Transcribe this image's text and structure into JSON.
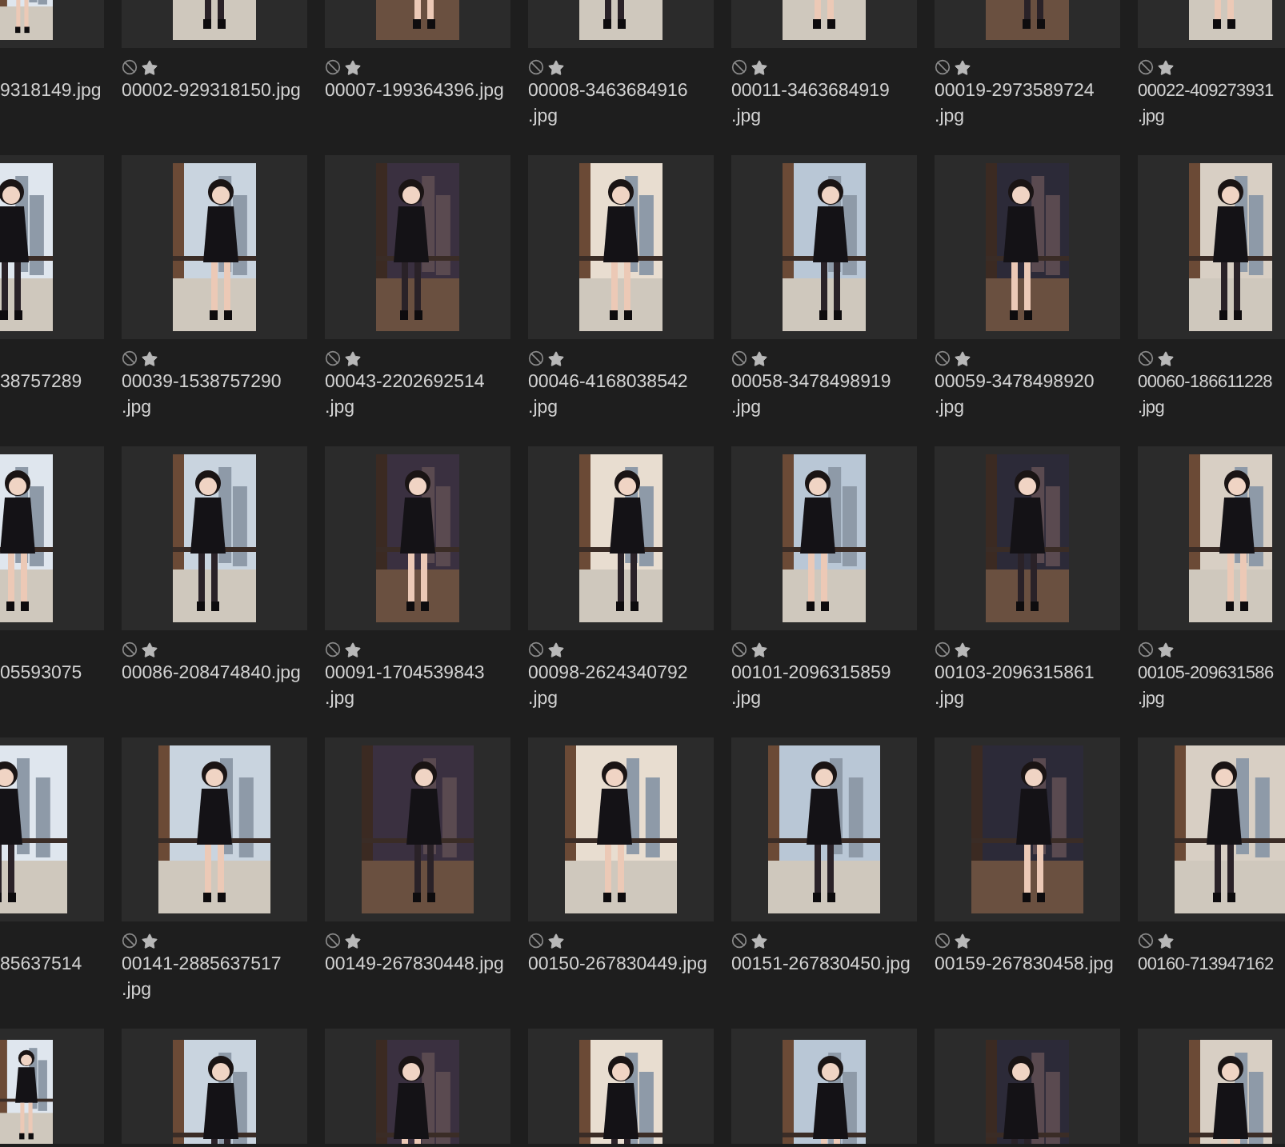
{
  "rows": [
    {
      "items": [
        {
          "name_lines": [
            "9318149.jpg"
          ]
        },
        {
          "name_lines": [
            "00002-929318150.jpg"
          ]
        },
        {
          "name_lines": [
            "00007-199364396.jpg"
          ]
        },
        {
          "name_lines": [
            "00008-3463684916",
            ".jpg"
          ]
        },
        {
          "name_lines": [
            "00011-3463684919",
            ".jpg"
          ]
        },
        {
          "name_lines": [
            "00019-2973589724",
            ".jpg"
          ]
        },
        {
          "name_lines": [
            "00022-409273931",
            ".jpg"
          ]
        }
      ]
    },
    {
      "items": [
        {
          "name_lines": [
            "38757289"
          ]
        },
        {
          "name_lines": [
            "00039-1538757290",
            ".jpg"
          ]
        },
        {
          "name_lines": [
            "00043-2202692514",
            ".jpg"
          ]
        },
        {
          "name_lines": [
            "00046-4168038542",
            ".jpg"
          ]
        },
        {
          "name_lines": [
            "00058-3478498919",
            ".jpg"
          ]
        },
        {
          "name_lines": [
            "00059-3478498920",
            ".jpg"
          ]
        },
        {
          "name_lines": [
            "00060-186611228",
            ".jpg"
          ]
        }
      ]
    },
    {
      "items": [
        {
          "name_lines": [
            "05593075"
          ]
        },
        {
          "name_lines": [
            "00086-208474840.jpg"
          ]
        },
        {
          "name_lines": [
            "00091-1704539843",
            ".jpg"
          ]
        },
        {
          "name_lines": [
            "00098-2624340792",
            ".jpg"
          ]
        },
        {
          "name_lines": [
            "00101-2096315859",
            ".jpg"
          ]
        },
        {
          "name_lines": [
            "00103-2096315861",
            ".jpg"
          ]
        },
        {
          "name_lines": [
            "00105-209631586",
            ".jpg"
          ]
        }
      ]
    },
    {
      "items": [
        {
          "name_lines": [
            "85637514"
          ]
        },
        {
          "name_lines": [
            "00141-2885637517",
            ".jpg"
          ]
        },
        {
          "name_lines": [
            "00149-267830448.jpg"
          ]
        },
        {
          "name_lines": [
            "00150-267830449.jpg"
          ]
        },
        {
          "name_lines": [
            "00151-267830450.jpg"
          ]
        },
        {
          "name_lines": [
            "00159-267830458.jpg"
          ]
        },
        {
          "name_lines": [
            "00160-713947162"
          ]
        }
      ]
    },
    {
      "items": [
        {
          "kind": "picture"
        },
        {
          "kind": "picture"
        },
        {
          "kind": "picture"
        },
        {
          "kind": "picture"
        },
        {
          "kind": "picture"
        },
        {
          "kind": "picture"
        },
        {
          "kind": "picture"
        }
      ]
    }
  ]
}
